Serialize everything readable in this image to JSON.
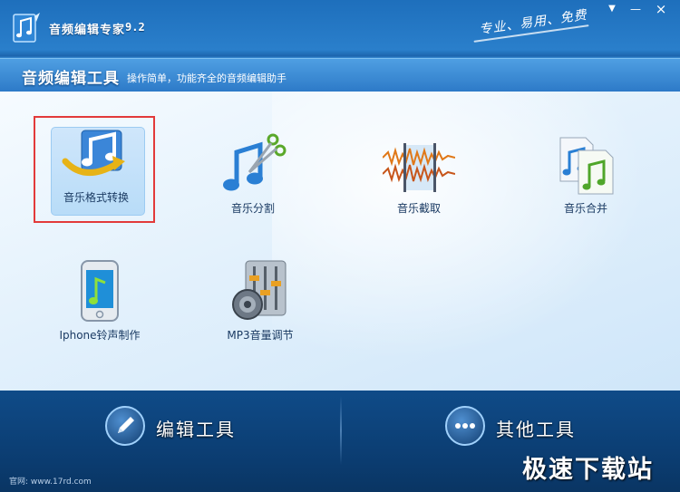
{
  "window": {
    "title": "音频编辑专家",
    "version": "9.2",
    "slogan": "专业、易用、免费",
    "controls": {
      "skin": "▼",
      "minimize": "—",
      "close": "×"
    }
  },
  "section": {
    "title": "音频编辑工具",
    "subtitle": "操作简单，功能齐全的音频编辑助手"
  },
  "tools": [
    {
      "label": "音乐格式转换",
      "icon": "music-convert-icon",
      "selected": true
    },
    {
      "label": "音乐分割",
      "icon": "music-scissors-icon",
      "selected": false
    },
    {
      "label": "音乐截取",
      "icon": "waveform-cut-icon",
      "selected": false
    },
    {
      "label": "音乐合并",
      "icon": "music-merge-icon",
      "selected": false
    },
    {
      "label": "Iphone铃声制作",
      "icon": "phone-ringtone-icon",
      "selected": false
    },
    {
      "label": "MP3音量调节",
      "icon": "volume-mixer-icon",
      "selected": false
    }
  ],
  "bottom": {
    "edit_tools": "编辑工具",
    "other_tools": "其他工具"
  },
  "footer": {
    "site": "官网: www.17rd.com"
  },
  "watermark": "极速下载站",
  "colors": {
    "selection_border": "#e23a3a",
    "accent": "#2c7ac6"
  }
}
